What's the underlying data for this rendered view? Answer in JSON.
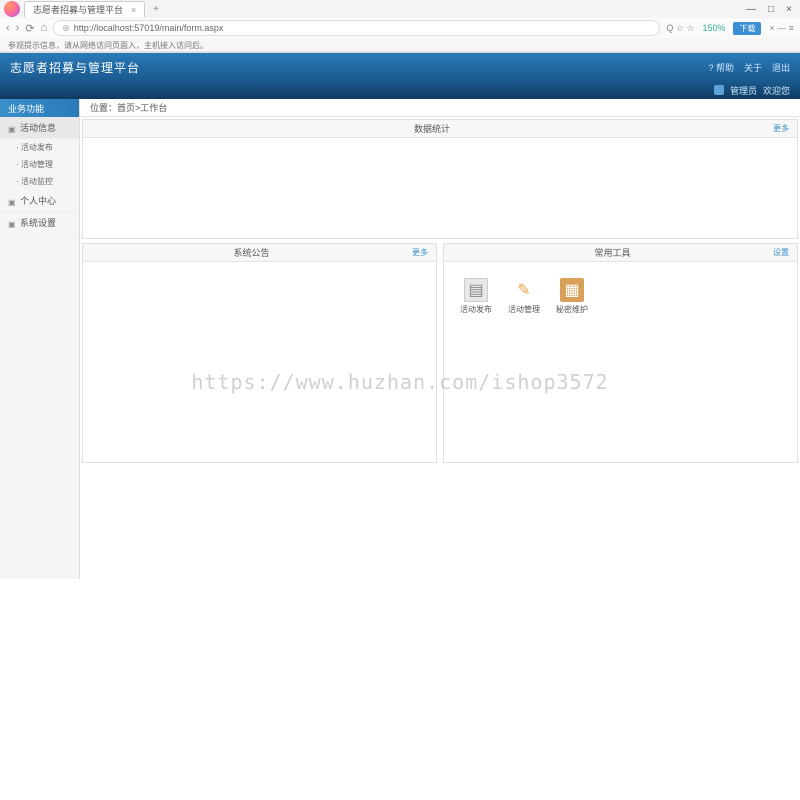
{
  "browser": {
    "tab_title": "志愿者招募与管理平台",
    "tab_close": "×",
    "tab_add": "+",
    "window": {
      "min": "—",
      "max": "□",
      "close": "×"
    },
    "url": "http://localhost:57019/main/form.aspx",
    "nav": {
      "back": "‹",
      "forward": "›",
      "reload": "⟳",
      "home": "⌂"
    },
    "zoom": "150%",
    "search_hint": "Q  ☆  ☆",
    "ext_label": "下载",
    "ext_right": "×  —  ≡",
    "bookmark_hint": "参观提示信息，请从网络访问页面入，主机接入访问后。"
  },
  "header": {
    "title": "志愿者招募与管理平台",
    "links": {
      "help": "? 帮助",
      "about": "关于",
      "logout": "退出"
    },
    "user_label": "管理员",
    "welcome": "欢迎您"
  },
  "sidebar": {
    "header": "业务功能",
    "items": [
      {
        "label": "活动信息"
      },
      {
        "label": "个人中心"
      },
      {
        "label": "系统设置"
      }
    ],
    "subs": [
      {
        "label": "· 活动发布"
      },
      {
        "label": "· 活动管理"
      },
      {
        "label": "· 活动监控"
      }
    ]
  },
  "breadcrumb": {
    "label": "位置：",
    "home": "首页",
    "sep": " > ",
    "current": "工作台"
  },
  "panels": {
    "stats": {
      "title": "数据统计",
      "action": "更多"
    },
    "announce": {
      "title": "系统公告",
      "action": "更多"
    },
    "tools": {
      "title": "常用工具",
      "action": "设置"
    }
  },
  "tools": [
    {
      "label": "活动发布",
      "icon": "doc"
    },
    {
      "label": "活动管理",
      "icon": "pencil"
    },
    {
      "label": "秘密维护",
      "icon": "folder"
    }
  ],
  "watermark": "https://www.huzhan.com/ishop3572"
}
